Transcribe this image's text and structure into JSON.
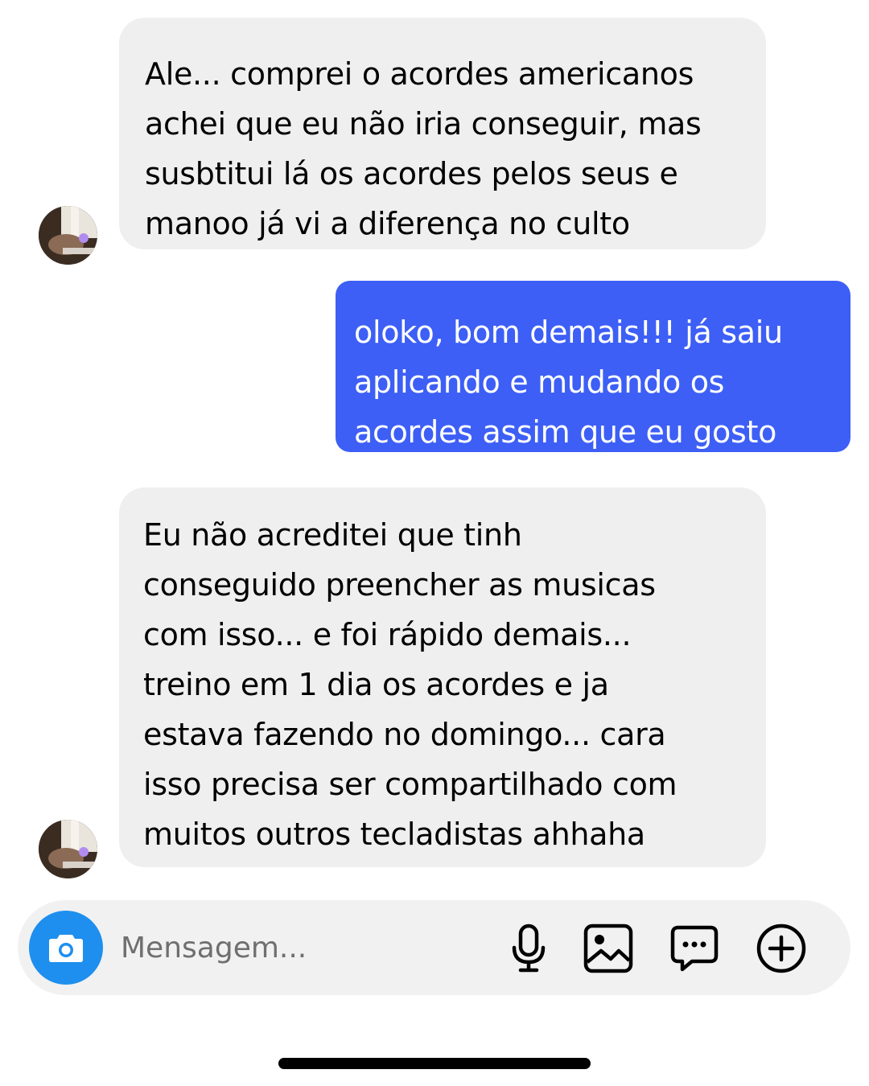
{
  "conversation": {
    "messages": [
      {
        "direction": "incoming",
        "lines": [
          "Ale... comprei o acordes americanos",
          "achei que eu não iria conseguir, mas",
          "susbtitui lá os acordes pelos seus e",
          "manoo já vi a diferença no culto"
        ]
      },
      {
        "direction": "outgoing",
        "lines": [
          "oloko, bom demais!!! já saiu",
          "aplicando e mudando os",
          "acordes assim que eu gosto"
        ]
      },
      {
        "direction": "incoming",
        "lines": [
          "Eu não acreditei que tinh",
          "conseguido preencher as musicas",
          "com isso... e foi rápido demais...",
          "treino em 1 dia os acordes e ja",
          "estava fazendo no domingo... cara",
          "isso precisa ser compartilhado com",
          "muitos outros tecladistas ahhaha"
        ]
      }
    ]
  },
  "composer": {
    "placeholder": "Mensagem...",
    "value": "",
    "icons": [
      "camera-icon",
      "microphone-icon",
      "image-gallery-icon",
      "sticker-icon",
      "plus-icon"
    ]
  },
  "colors": {
    "incoming_bubble": "#efefef",
    "outgoing_bubble": "#3d5ff6",
    "camera_button": "#1e8fee",
    "composer_background": "#f1f1f1"
  }
}
